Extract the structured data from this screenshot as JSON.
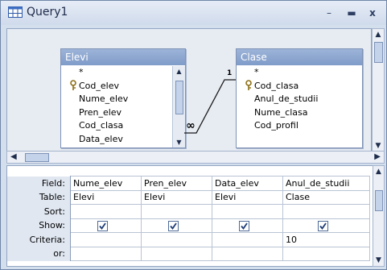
{
  "window": {
    "title": "Query1",
    "minimize": "–",
    "maximize": "▬",
    "close": "x"
  },
  "tables": {
    "elevi": {
      "name": "Elevi",
      "fields": [
        "*",
        "Cod_elev",
        "Nume_elev",
        "Pren_elev",
        "Cod_clasa",
        "Data_elev"
      ],
      "key_field": "Cod_elev"
    },
    "clase": {
      "name": "Clase",
      "fields": [
        "*",
        "Cod_clasa",
        "Anul_de_studii",
        "Nume_clasa",
        "Cod_profil"
      ],
      "key_field": "Cod_clasa"
    }
  },
  "relationship": {
    "one_label": "1",
    "many_label": "∞"
  },
  "grid": {
    "row_labels": {
      "field": "Field:",
      "table": "Table:",
      "sort": "Sort:",
      "show": "Show:",
      "criteria": "Criteria:",
      "or": "or:"
    },
    "columns": [
      {
        "field": "Nume_elev",
        "table": "Elevi",
        "sort": "",
        "show": true,
        "criteria": ""
      },
      {
        "field": "Pren_elev",
        "table": "Elevi",
        "sort": "",
        "show": true,
        "criteria": ""
      },
      {
        "field": "Data_elev",
        "table": "Elevi",
        "sort": "",
        "show": true,
        "criteria": ""
      },
      {
        "field": "Anul_de_studii",
        "table": "Clase",
        "sort": "",
        "show": true,
        "criteria": "10"
      }
    ]
  },
  "colors": {
    "title_text": "#1e2b4a",
    "table_header": "#8aa3cf",
    "key_icon": "#b8962b"
  }
}
